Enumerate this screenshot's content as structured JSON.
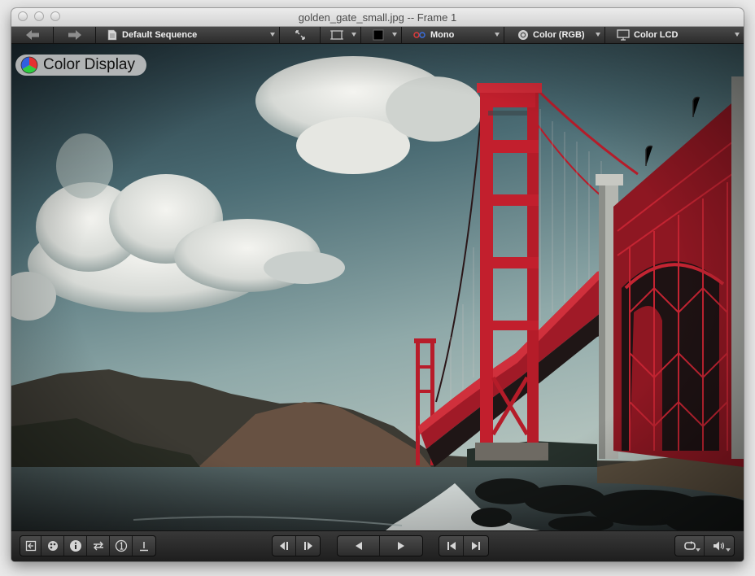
{
  "window": {
    "title": "golden_gate_small.jpg -- Frame 1"
  },
  "toolbar": {
    "sequence_label": "Default Sequence",
    "channel_label": "Mono",
    "color_mode_label": "Color (RGB)",
    "display_label": "Color LCD"
  },
  "overlay": {
    "color_display_label": "Color Display"
  },
  "colors": {
    "bridge_red": "#c81e2e",
    "toolbar_bg": "#2f2f2f",
    "window_bg": "#262626"
  },
  "icons": {
    "back": "arrow-left-icon",
    "forward": "arrow-right-icon",
    "sequence": "document-icon",
    "fit": "fit-arrows-icon",
    "crop": "crop-frame-icon",
    "background": "black-swatch-icon",
    "channel": "rgb-dots-icon",
    "color_mode": "color-circle-icon",
    "display": "monitor-icon",
    "export": "export-icon",
    "palette": "palette-icon",
    "info": "info-icon",
    "swap": "swap-arrows-icon",
    "one_to_one": "one-to-one-icon",
    "set_frame": "set-frame-icon",
    "step_back": "step-back-icon",
    "step_forward": "step-forward-icon",
    "play_back": "play-backward-icon",
    "play_forward": "play-forward-icon",
    "go_start": "go-to-start-icon",
    "go_end": "go-to-end-icon",
    "loop": "loop-icon",
    "volume": "volume-icon"
  }
}
